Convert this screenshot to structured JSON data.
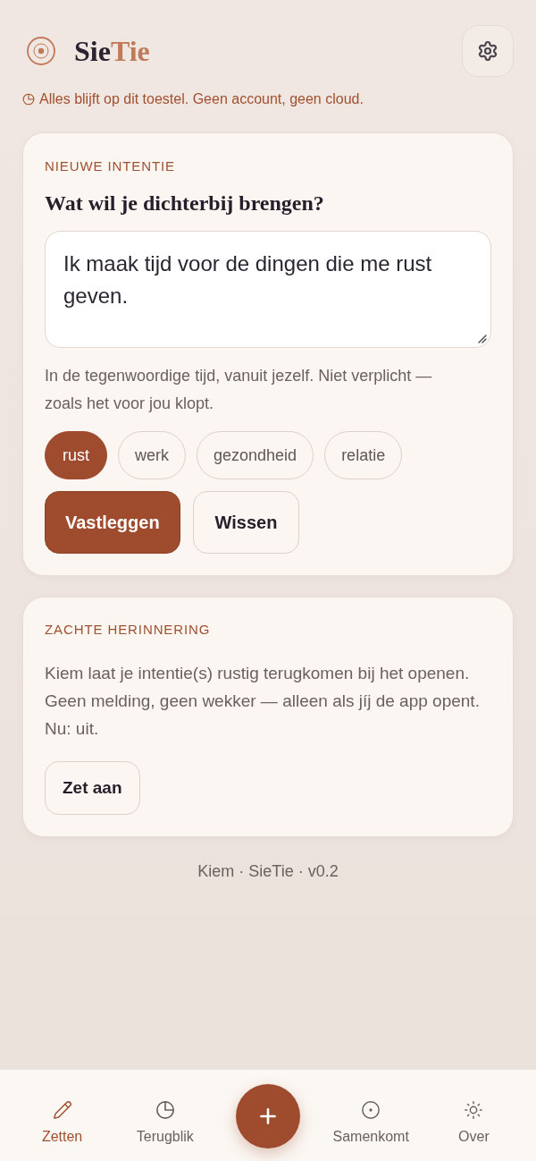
{
  "header": {
    "brand": {
      "text": "Sie",
      "accent_text": "Tie"
    },
    "privacy_note": "Alles blijft op dit toestel. Geen account, geen cloud."
  },
  "intention_card": {
    "eyebrow": "NIEUWE INTENTIE",
    "heading": "Wat wil je dichterbij brengen?",
    "intention": {
      "value": "Ik maak tijd voor de dingen die me rust geven."
    },
    "hint": "In de tegenwoordige tijd, vanuit jezelf. Niet verplicht — zoals het voor jou klopt.",
    "tags": [
      {
        "label": "rust",
        "selected": true
      },
      {
        "label": "werk",
        "selected": false
      },
      {
        "label": "gezondheid",
        "selected": false
      },
      {
        "label": "relatie",
        "selected": false
      }
    ],
    "buttons": [
      {
        "label": "Vastleggen",
        "kind": "primary"
      },
      {
        "label": "Wissen",
        "kind": "secondary"
      }
    ]
  },
  "reminder_card": {
    "eyebrow": "ZACHTE HERINNERING",
    "body": "Kiem laat je intentie(s) rustig terugkomen bij het openen. Geen melding, geen wekker — alleen als jíj de app opent. Nu: uit.",
    "button": "Zet aan"
  },
  "footer": "Kiem · SieTie · v0.2",
  "bottom_nav": {
    "items": [
      {
        "kind": "tab",
        "label": "Zetten",
        "selected": true
      },
      {
        "kind": "tab",
        "label": "Terugblik",
        "selected": false
      },
      {
        "kind": "fab"
      },
      {
        "kind": "tab",
        "label": "Samenkomt",
        "selected": false
      },
      {
        "kind": "tab",
        "label": "Over",
        "selected": false
      }
    ]
  }
}
